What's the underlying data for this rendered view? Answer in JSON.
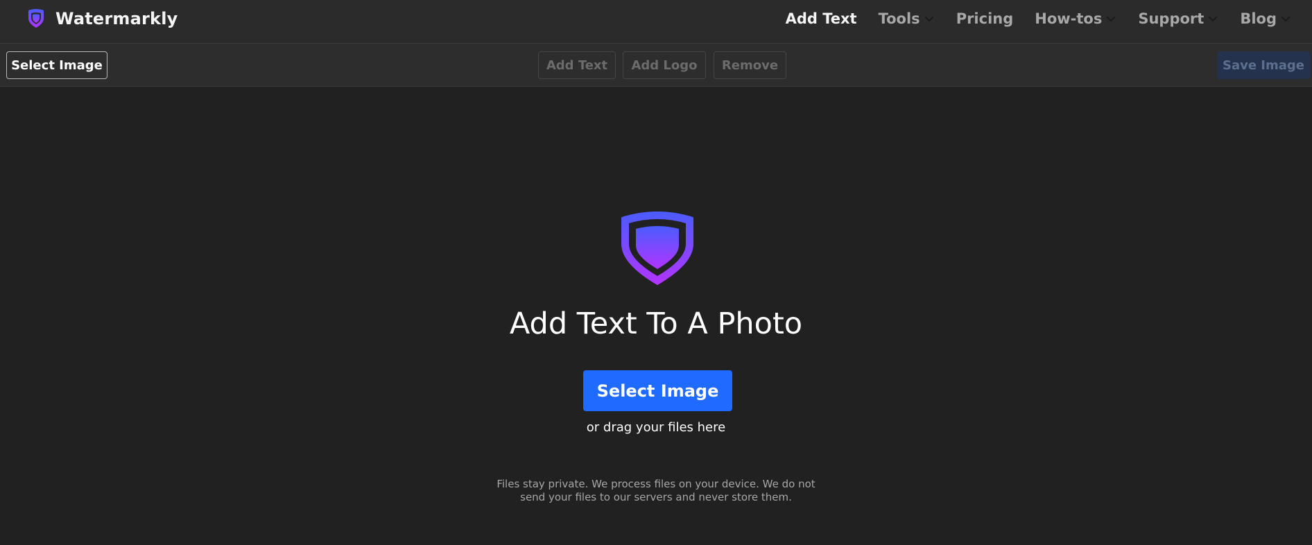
{
  "brand": {
    "name": "Watermarkly",
    "icon": "shield-icon"
  },
  "nav": {
    "items": [
      {
        "label": "Add Text",
        "active": true,
        "dropdown": false
      },
      {
        "label": "Tools",
        "active": false,
        "dropdown": true
      },
      {
        "label": "Pricing",
        "active": false,
        "dropdown": false
      },
      {
        "label": "How-tos",
        "active": false,
        "dropdown": true
      },
      {
        "label": "Support",
        "active": false,
        "dropdown": true
      },
      {
        "label": "Blog",
        "active": false,
        "dropdown": true
      }
    ]
  },
  "toolbar": {
    "select_image": "Select Image",
    "add_text": "Add Text",
    "add_logo": "Add Logo",
    "remove": "Remove",
    "save_image": "Save Image"
  },
  "hero": {
    "title": "Add Text To A Photo",
    "button": "Select Image",
    "drag_hint": "or drag your files here",
    "privacy_line1": "Files stay private. We process files on your device. We do not",
    "privacy_line2": "send your files to our servers and never store them."
  },
  "colors": {
    "background": "#212121",
    "navbar": "#2b2b2b",
    "primary": "#1f6bff",
    "shield_top": "#4a5cff",
    "shield_bottom": "#b234ff"
  }
}
